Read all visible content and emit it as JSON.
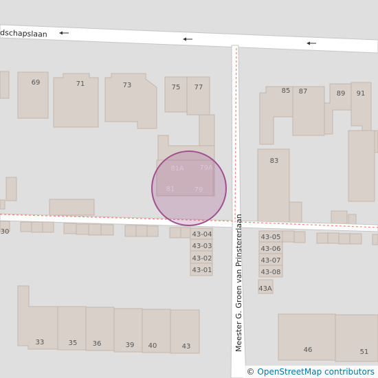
{
  "map": {
    "streets": {
      "top": "dschapslaan",
      "vertical": "Meester G. Groen van Prinstererlaan"
    },
    "house_numbers": {
      "n69": "69",
      "n71": "71",
      "n73": "73",
      "n75": "75",
      "n77": "77",
      "n81a": "81A",
      "n79a": "79A",
      "n81": "81",
      "n79": "79",
      "n85": "85",
      "n87": "87",
      "n89": "89",
      "n91": "91",
      "n83": "83",
      "n30": "30",
      "n43_04": "43-04",
      "n43_03": "43-03",
      "n43_02": "43-02",
      "n43_01": "43-01",
      "n43_05": "43-05",
      "n43_06": "43-06",
      "n43_07": "43-07",
      "n43_08": "43-08",
      "n43a": "43A",
      "n33": "33",
      "n35": "35",
      "n36": "36",
      "n39": "39",
      "n40": "40",
      "n43": "43",
      "n46": "46",
      "n51": "51"
    },
    "marker_color": "#a0508f",
    "attribution": {
      "symbol": "©",
      "text": "OpenStreetMap contributors"
    }
  }
}
